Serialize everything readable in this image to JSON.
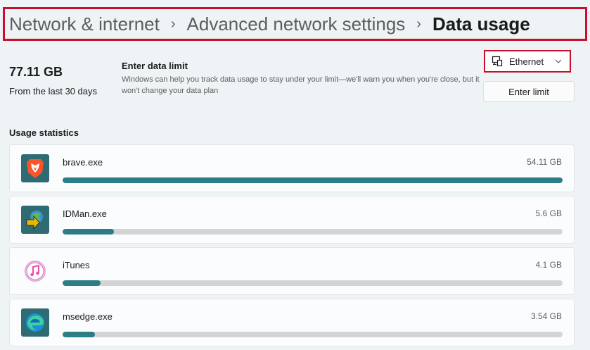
{
  "breadcrumb": {
    "items": [
      "Network & internet",
      "Advanced network settings",
      "Data usage"
    ],
    "separator": "›"
  },
  "summary": {
    "total": "77.11 GB",
    "caption": "From the last 30 days"
  },
  "limit": {
    "title": "Enter data limit",
    "description": "Windows can help you track data usage to stay under your limit—we'll warn you when you're close, but it won't change your data plan",
    "button": "Enter limit"
  },
  "network_select": {
    "value": "Ethernet",
    "icon": "ethernet-icon"
  },
  "usage": {
    "title": "Usage statistics",
    "apps": [
      {
        "name": "brave.exe",
        "usage": "54.11 GB",
        "fraction": 1.0,
        "icon": "brave-icon",
        "color": "#fb542b"
      },
      {
        "name": "IDMan.exe",
        "usage": "5.6 GB",
        "fraction": 0.103,
        "icon": "idman-icon",
        "color": "#2b8a3e"
      },
      {
        "name": "iTunes",
        "usage": "4.1 GB",
        "fraction": 0.076,
        "icon": "itunes-icon",
        "color": "#fa57c1"
      },
      {
        "name": "msedge.exe",
        "usage": "3.54 GB",
        "fraction": 0.065,
        "icon": "edge-icon",
        "color": "#1d8fd8"
      }
    ]
  },
  "colors": {
    "accent": "#2d7d87",
    "highlight_border": "#c8102e"
  }
}
